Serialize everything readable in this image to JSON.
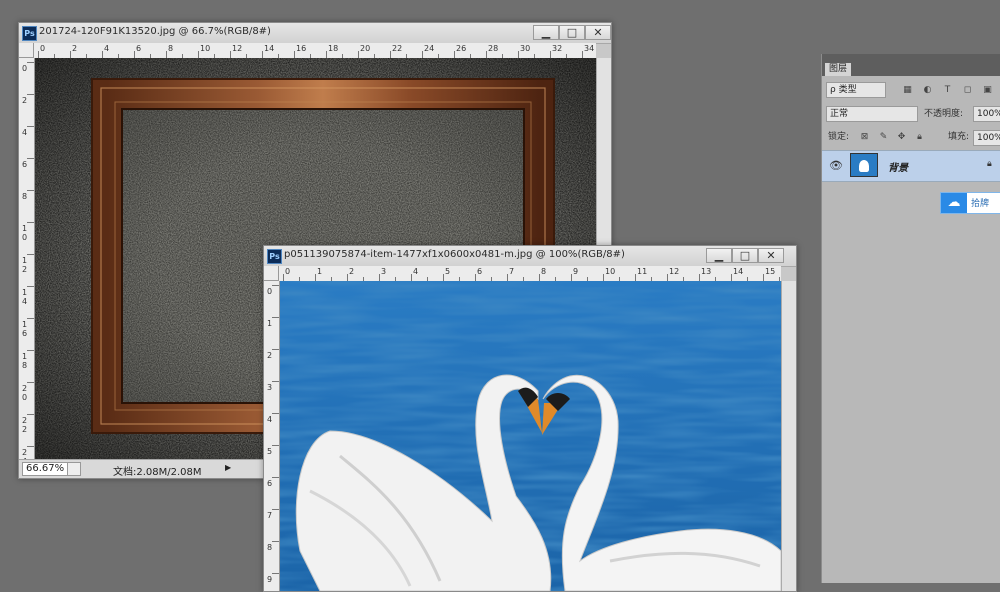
{
  "window1": {
    "title": "201724-120F91K13520.jpg @ 66.7%(RGB/8#)",
    "minimize_label": "▁",
    "maximize_label": "□",
    "close_label": "✕",
    "h_ruler_labels": [
      "0",
      "2",
      "4",
      "6",
      "8",
      "10",
      "12",
      "14",
      "16",
      "18",
      "20",
      "22",
      "24",
      "26",
      "28",
      "30",
      "32",
      "34"
    ],
    "v_ruler_labels": [
      "0",
      "2",
      "4",
      "6",
      "8",
      "10",
      "12",
      "14",
      "16",
      "18",
      "20",
      "22",
      "24"
    ],
    "zoom": "66.67%",
    "doc_info": "文档:2.08M/2.08M",
    "arrow": "▶"
  },
  "window2": {
    "title": "p051139075874-item-1477xf1x0600x0481-m.jpg @ 100%(RGB/8#)",
    "minimize_label": "▁",
    "maximize_label": "□",
    "close_label": "✕",
    "h_ruler_labels": [
      "0",
      "1",
      "2",
      "3",
      "4",
      "5",
      "6",
      "7",
      "8",
      "9",
      "10",
      "11",
      "12",
      "13",
      "14",
      "15"
    ],
    "v_ruler_labels": [
      "0",
      "1",
      "2",
      "3",
      "4",
      "5",
      "6",
      "7",
      "8",
      "9"
    ]
  },
  "layers_panel": {
    "tab_label": "图层",
    "filter_label": "ρ 类型",
    "blend_mode": "正常",
    "opacity_label": "不透明度:",
    "opacity_value": "100%",
    "lock_label": "锁定:",
    "fill_label": "填充:",
    "fill_value": "100%",
    "layer_name": "背景",
    "cloud_button_label": "拾牌"
  },
  "colors": {
    "app_bg": "#6f6f6f",
    "water": "#1f6fb3",
    "frame_wood": "#7a4426",
    "layer_selected": "#bcd0ea"
  }
}
